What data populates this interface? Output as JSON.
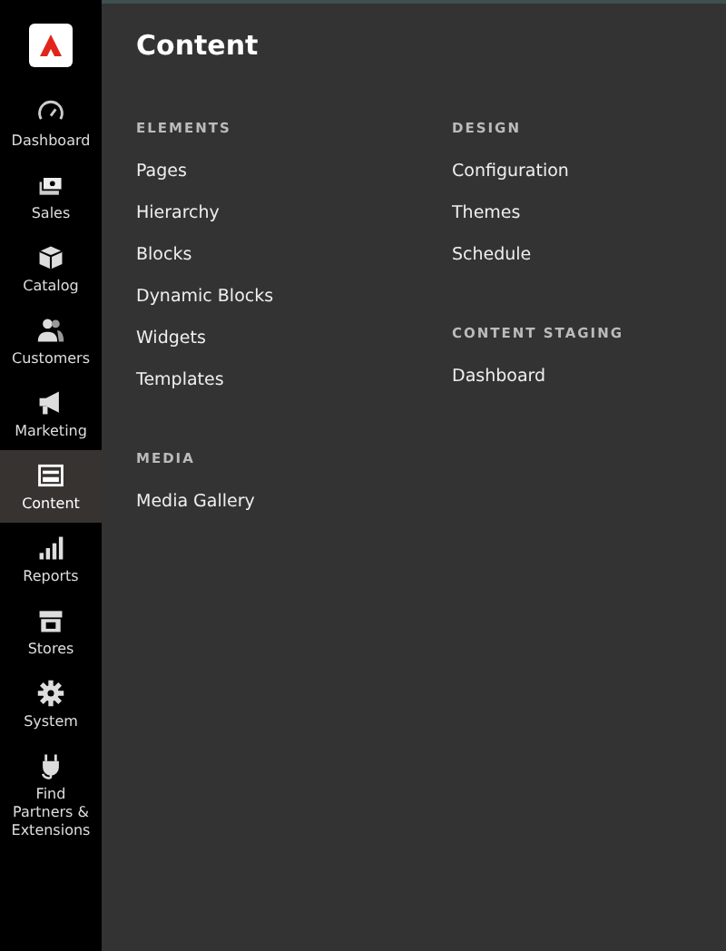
{
  "sidebar": {
    "items": [
      {
        "label": "Dashboard",
        "selected": false
      },
      {
        "label": "Sales",
        "selected": false
      },
      {
        "label": "Catalog",
        "selected": false
      },
      {
        "label": "Customers",
        "selected": false
      },
      {
        "label": "Marketing",
        "selected": false
      },
      {
        "label": "Content",
        "selected": true
      },
      {
        "label": "Reports",
        "selected": false
      },
      {
        "label": "Stores",
        "selected": false
      },
      {
        "label": "System",
        "selected": false
      },
      {
        "label": "Find Partners & Extensions",
        "selected": false
      }
    ]
  },
  "panel": {
    "title": "Content",
    "columns": [
      {
        "sections": [
          {
            "heading": "ELEMENTS",
            "items": [
              "Pages",
              "Hierarchy",
              "Blocks",
              "Dynamic Blocks",
              "Widgets",
              "Templates"
            ]
          },
          {
            "heading": "MEDIA",
            "items": [
              "Media Gallery"
            ]
          }
        ]
      },
      {
        "sections": [
          {
            "heading": "DESIGN",
            "items": [
              "Configuration",
              "Themes",
              "Schedule"
            ]
          },
          {
            "heading": "CONTENT STAGING",
            "items": [
              "Dashboard"
            ]
          }
        ]
      }
    ]
  }
}
